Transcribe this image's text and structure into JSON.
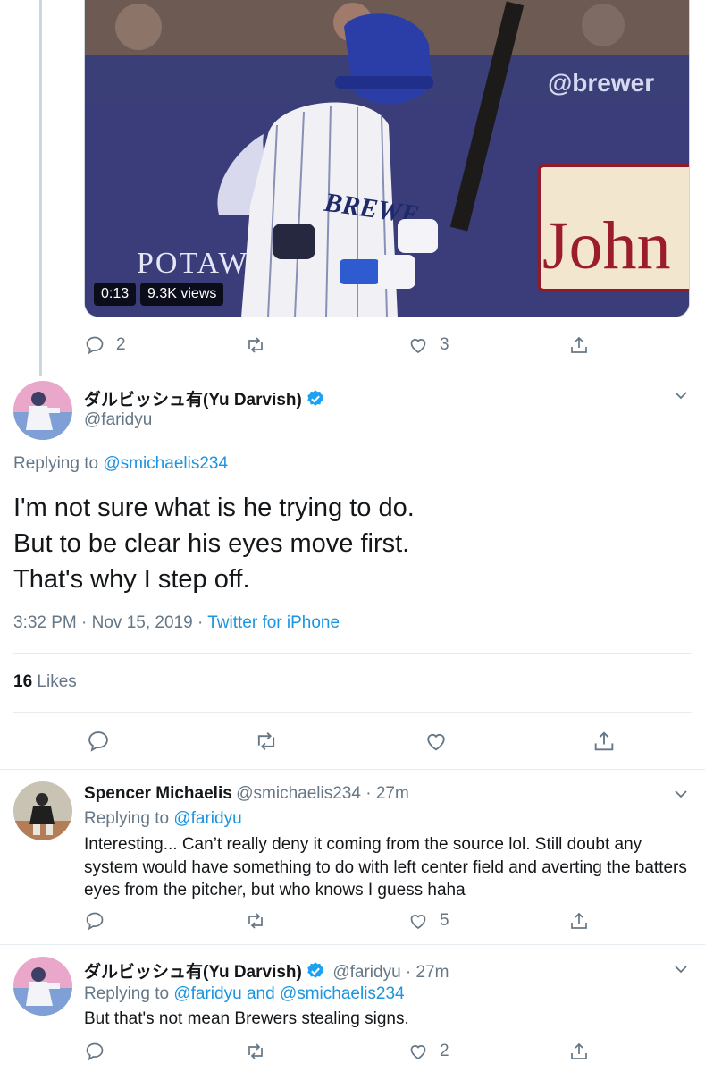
{
  "video": {
    "duration": "0:13",
    "views": "9.3K views",
    "signage": {
      "brewer": "@brewer",
      "potaw": "POTAW",
      "john": "John",
      "jersey": "BREWE"
    }
  },
  "first_tweet_actions": {
    "reply_count": "2",
    "retweet_count": "",
    "like_count": "3"
  },
  "main_tweet": {
    "display_name": "ダルビッシュ有(Yu Darvish)",
    "handle": "@faridyu",
    "replying_prefix": "Replying to ",
    "replying_to": "@smichaelis234",
    "text_lines": [
      "I'm not sure what is he trying to do.",
      "But to be clear his eyes move first.",
      "That's why I step off."
    ],
    "timestamp": "3:32 PM · Nov 15, 2019 · ",
    "source": "Twitter for iPhone",
    "likes_count": "16",
    "likes_label": "Likes"
  },
  "reply1": {
    "display_name": "Spencer Michaelis",
    "handle_time": "@smichaelis234 · 27m",
    "replying_prefix": "Replying to ",
    "replying_to": "@faridyu",
    "text": "Interesting... Can’t really deny it coming from the source lol. Still doubt any system would have something to do with left center field and averting the batters eyes from the pitcher, but who knows I guess haha",
    "like_count": "5"
  },
  "reply2": {
    "display_name": "ダルビッシュ有(Yu Darvish)",
    "handle_time": "@faridyu · 27m",
    "replying_prefix": "Replying to ",
    "replying_to_1": "@faridyu",
    "replying_and": " and ",
    "replying_to_2": "@smichaelis234",
    "text": "But that's not mean Brewers stealing signs.",
    "like_count": "2"
  },
  "colors": {
    "link": "#1b95e0",
    "secondary_text": "#657786",
    "divider": "#e6ecf0",
    "verified": "#1da1f2"
  },
  "icons": [
    "reply-icon",
    "retweet-icon",
    "like-icon",
    "share-icon",
    "chevron-down-icon",
    "verified-badge-icon"
  ]
}
